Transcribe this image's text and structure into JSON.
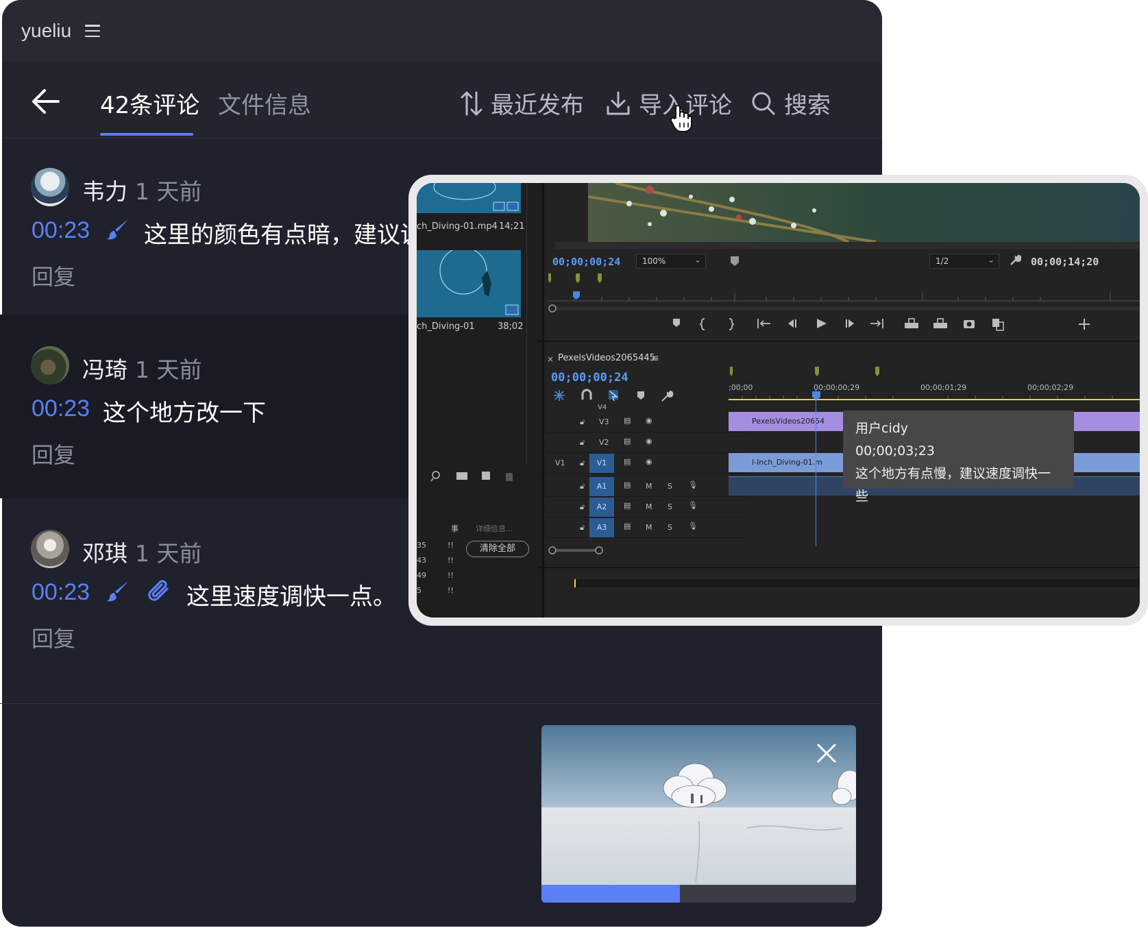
{
  "header": {
    "username": "yueliu"
  },
  "tabs": {
    "comments": "42条评论",
    "file_info": "文件信息"
  },
  "toolbar": {
    "sort": "最近发布",
    "import": "导入评论",
    "search": "搜索"
  },
  "comments": [
    {
      "name": "韦力",
      "time": "1 天前",
      "timestamp": "00:23",
      "text": "这里的颜色有点暗，建议调",
      "reply": "回复"
    },
    {
      "name": "冯琦",
      "time": "1 天前",
      "timestamp": "00:23",
      "text": "这个地方改一下",
      "reply": "回复"
    },
    {
      "name": "邓琪",
      "time": "1 天前",
      "timestamp": "00:23",
      "text": "这里速度调快一点。",
      "reply": "回复"
    }
  ],
  "video": {
    "progress": 0.44
  },
  "editor": {
    "clips": [
      {
        "name": "ch_Diving-01.mp4",
        "duration": "14;21"
      },
      {
        "name": "ch_Diving-01",
        "duration": "38;02"
      }
    ],
    "monitor_time": "00;00;00;24",
    "zoom": "100%",
    "resolution": "1/2",
    "monitor_duration": "00;00;14;20",
    "sequence": "PexelsVideos2065445",
    "sequence_time": "00;00;00;24",
    "ruler": [
      ";00;00",
      "00;00;00;29",
      "00;00;01;29",
      "00;00;02;29"
    ],
    "tracks_video": [
      "V4",
      "V3",
      "V2",
      "V1"
    ],
    "tracks_audio": [
      "A1",
      "A2",
      "A3"
    ],
    "source_patch": "V1",
    "track_m": "M",
    "track_s": "S",
    "clip_v3": "PexelsVideos20654",
    "clip_v1": "l-Inch_Diving-01.m",
    "detail_label": "详细信息...",
    "event_label": "事",
    "clear_all": "清除全部",
    "event_rows": [
      "35",
      "43",
      "49",
      "5"
    ],
    "event_mark": "!!",
    "tooltip": {
      "user": "用户cidy",
      "time": "00;00;03;23",
      "text": "这个地方有点慢，建议速度调快一些"
    }
  },
  "colors": {
    "accent": "#5b7ff7",
    "panel_bg": "#1f212c"
  }
}
